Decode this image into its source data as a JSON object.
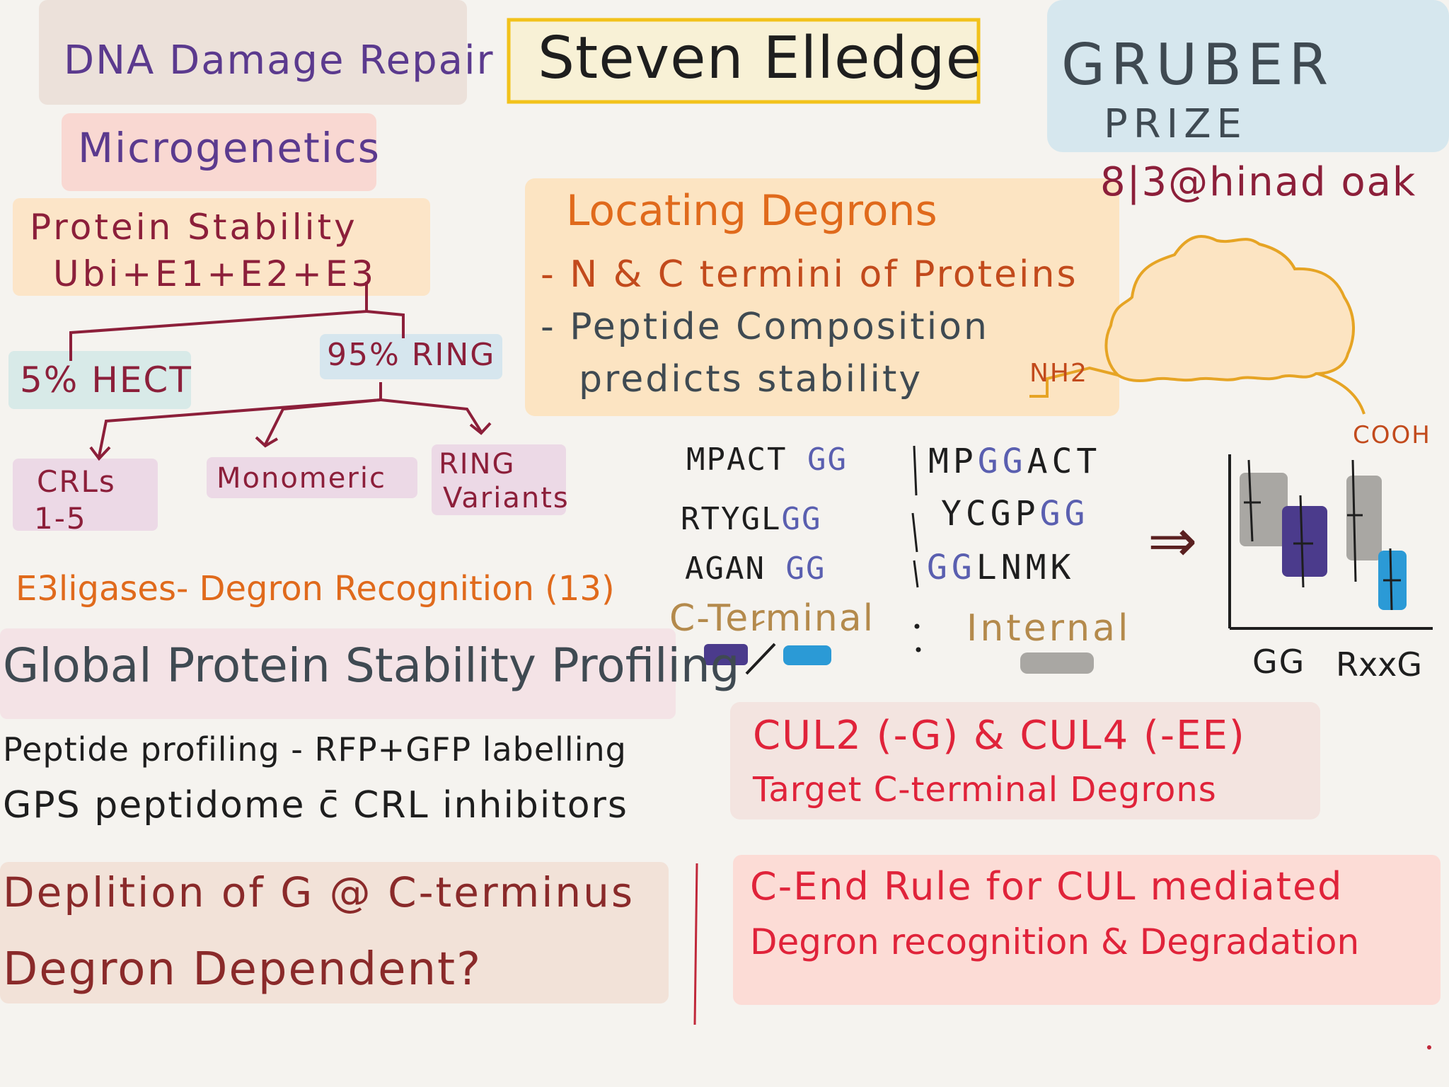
{
  "header": {
    "title": "Steven Elledge",
    "topic": "DNA Damage Repair",
    "subtopic": "Microgenetics",
    "award_line1": "GRUBER",
    "award_line2": "PRIZE",
    "date_location": "8|3@hinad oak"
  },
  "protein_stability": {
    "title": "Protein Stability",
    "formula": "Ubi+E1+E2+E3",
    "hect": "5% HECT",
    "ring": "95% RING",
    "crls_line1": "CRLs",
    "crls_line2": "1-5",
    "monomeric": "Monomeric",
    "ring_variants_line1": "RING",
    "ring_variants_line2": "Variants",
    "e3_note": "E3ligases- Degron Recognition (13)"
  },
  "locating_degrons": {
    "title": "Locating Degrons",
    "items": [
      "- N & C termini of Proteins",
      "- Peptide Composition",
      "predicts stability"
    ]
  },
  "protein_diagram": {
    "nh2": "NH2",
    "cooh": "COOH"
  },
  "sequences": {
    "c_terminal": [
      {
        "prefix": "MPACT",
        "gg": "GG"
      },
      {
        "prefix": "RTYGL",
        "gg": "GG"
      },
      {
        "prefix": "AGAN",
        "gg": "GG"
      }
    ],
    "internal": [
      {
        "pre": "MP",
        "gg": "GG",
        "post": "ACT"
      },
      {
        "pre": "YCGP",
        "gg": "GG",
        "post": ""
      },
      {
        "pre": "",
        "gg": "GG",
        "post": "LNMK"
      }
    ],
    "c_terminal_label": "C-Terminal",
    "internal_label": "Internal",
    "arrow": "⇒"
  },
  "box_plot": {
    "x_labels": [
      "GG",
      "RxxG"
    ],
    "colors": {
      "gray": "#a9a7a3",
      "purple": "#4b3b8c",
      "blue": "#2b9ad6"
    }
  },
  "global_profiling": {
    "title": "Global Protein Stability Profiling",
    "line1": "Peptide profiling - RFP+GFP labelling",
    "line2": "GPS peptidome c̄ CRL inhibitors"
  },
  "cul_box": {
    "line1": "CUL2 (-G) & CUL4 (-EE)",
    "line2": "Target C-terminal Degrons"
  },
  "depletion": {
    "line1": "Deplition of G @ C-terminus",
    "line2": "Degron Dependent?"
  },
  "c_end_rule": {
    "line1": "C-End Rule for CUL mediated",
    "line2": "Degron recognition & Degradation"
  }
}
